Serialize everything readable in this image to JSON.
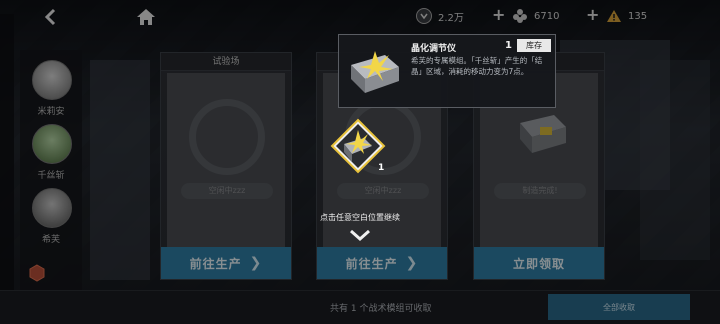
{
  "topbar": {
    "resources": [
      {
        "icon": "coin-icon",
        "value": "2.2万"
      },
      {
        "icon": "flower-token-icon",
        "value": "6710"
      },
      {
        "icon": "warning-triangle-icon",
        "value": "135"
      }
    ]
  },
  "characters": [
    {
      "name": "米莉安"
    },
    {
      "name": "千丝斩"
    },
    {
      "name": "希芙"
    }
  ],
  "cards": [
    {
      "header": "试验场",
      "status": "空闲中zzz",
      "button": "前往生产",
      "has_arrow": true
    },
    {
      "header": "",
      "status": "空闲中zzz",
      "button": "前往生产",
      "has_arrow": true
    },
    {
      "header": "",
      "status": "制造完成!",
      "button": "立即领取",
      "has_arrow": false
    }
  ],
  "tooltip": {
    "title": "晶化调节仪",
    "count": "1",
    "stock_label": "库存",
    "description": "希芙的专属模组。「千丝斩」产生的「结晶」区域，消耗的移动力变为7点。"
  },
  "selected_item": {
    "qty": "1"
  },
  "hint": "点击任意空白位置继续",
  "bottom": {
    "summary": "共有  1 个战术模组可收取",
    "collect_all": "全部收取"
  },
  "colors": {
    "accent": "#2f7fa6",
    "gold": "#e8c23a"
  }
}
